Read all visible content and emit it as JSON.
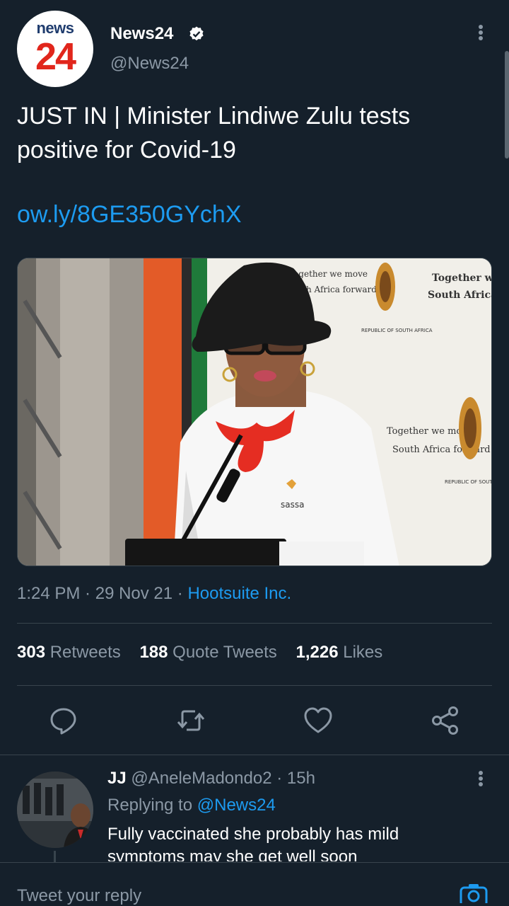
{
  "author": {
    "avatar_top": "news",
    "avatar_bottom": "24",
    "name": "News24",
    "handle": "@News24"
  },
  "tweet": {
    "text": "JUST IN | Minister Lindiwe Zulu tests positive for Covid-19",
    "link": "ow.ly/8GE350GYchX",
    "time": "1:24 PM",
    "date": "29 Nov 21",
    "source": "Hootsuite Inc."
  },
  "media": {
    "banner1_line1": "Together we move",
    "banner1_line2": "South Africa forward",
    "banner_small_line1": "Together we move",
    "banner_small_line2": "South Africa forward",
    "republic": "REPUBLIC OF SOUTH AFRICA",
    "banner2_line1": "Together we move",
    "banner2_line2": "South Africa forward",
    "republic2": "REPUBLIC OF SOUTH AFRICA",
    "shirt_logo": "sassa"
  },
  "stats": {
    "retweets_count": "303",
    "retweets_label": "Retweets",
    "quotes_count": "188",
    "quotes_label": "Quote Tweets",
    "likes_count": "1,226",
    "likes_label": "Likes"
  },
  "actions": [
    "reply-icon",
    "retweet-icon",
    "like-icon",
    "share-icon"
  ],
  "reply": {
    "name": "JJ",
    "handle": "@AneleMadondo2",
    "time": "15h",
    "replying_prefix": "Replying to",
    "replying_to": "@News24",
    "text": "Fully vaccinated she probably has mild symptoms may she get well soon"
  },
  "composer": {
    "placeholder": "Tweet your reply"
  },
  "colors": {
    "background": "#15202b",
    "accent": "#1d9bf0",
    "muted": "#8b98a5",
    "divider": "#38444d"
  }
}
